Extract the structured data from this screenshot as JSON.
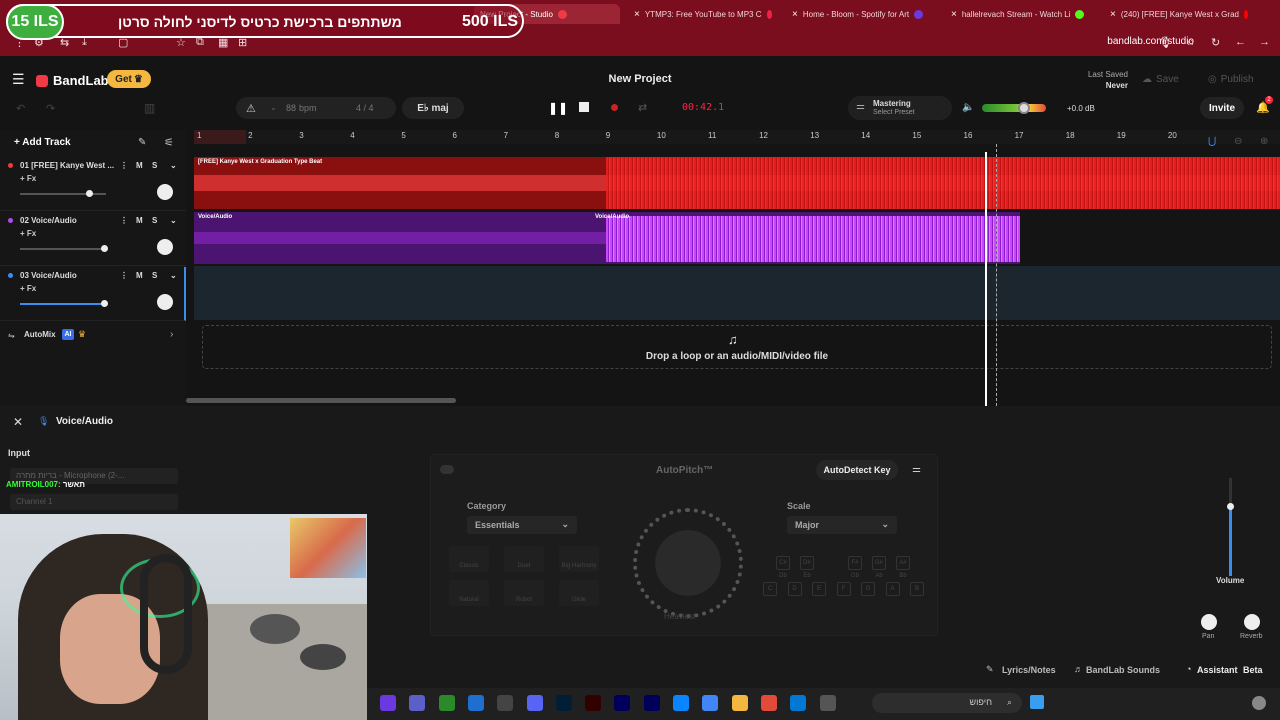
{
  "browser": {
    "tabs": [
      {
        "label": "New Project - Studio",
        "fav_color": "#f03a47"
      },
      {
        "label": "YTMP3: Free YouTube to MP3 C",
        "fav_color": "#e24"
      },
      {
        "label": "Home - Bloom - Spotify for Art",
        "fav_color": "#6a3ae0"
      },
      {
        "label": "hallelrevach Stream - Watch Li",
        "fav_color": "#53fc18"
      },
      {
        "label": "(240) [FREE] Kanye West x Grad",
        "fav_color": "#f00"
      }
    ],
    "url": "bandlab.com/studio"
  },
  "overlay": {
    "left_amount": "15 ILS",
    "message": "משתתפים ברכישת כרטיס לדיסני לחולה סרטן",
    "right_amount": "500 ILS"
  },
  "header": {
    "logo": "BandLab",
    "get_label": "Get",
    "project_title": "New Project",
    "last_saved_label": "Last Saved",
    "last_saved_value": "Never",
    "save_label": "Save",
    "publish_label": "Publish"
  },
  "transport": {
    "bpm_value": "88",
    "bpm_label": "bpm",
    "time_signature": "4 / 4",
    "key": "E♭ maj",
    "timecode": "00:42.1",
    "mastering_label": "Mastering",
    "mastering_preset": "Select Preset",
    "volume_db": "+0.0 dB",
    "invite_label": "Invite",
    "notif_count": "2"
  },
  "tracks_panel": {
    "add_track_label": "Add Track",
    "tracks": [
      {
        "name": "01  [FREE] Kanye West ...",
        "fx": "+ Fx",
        "m": "M",
        "s": "S",
        "color": "#f23a3a",
        "vol": 0.8
      },
      {
        "name": "02  Voice/Audio",
        "fx": "+ Fx",
        "m": "M",
        "s": "S",
        "color": "#b04af0",
        "vol": 0.98
      },
      {
        "name": "03  Voice/Audio",
        "fx": "+ Fx",
        "m": "M",
        "s": "S",
        "color": "#3a8ef0",
        "vol": 0.98
      }
    ],
    "automix_label": "AutoMix",
    "ai_badge": "AI"
  },
  "timeline": {
    "bars": [
      "1",
      "2",
      "3",
      "4",
      "5",
      "6",
      "7",
      "8",
      "9",
      "10",
      "11",
      "12",
      "13",
      "14",
      "15",
      "16",
      "17",
      "18",
      "19",
      "20"
    ],
    "clip1_label": "[FREE] Kanye West x Graduation Type Beat",
    "clip2a_label": "Voice/Audio",
    "clip2b_label": "Voice/Audio",
    "drop_text": "Drop a loop or an audio/MIDI/video file"
  },
  "editor": {
    "title": "Voice/Audio",
    "input_label": "Input",
    "mic_select": "בריות מחרה - Microphone (2-...",
    "channel_select": "Channel 1",
    "chat_user": "AMITROIL007:",
    "chat_msg": "תאשר",
    "autopitch_title": "AutoPitch™",
    "autodetect_label": "AutoDetect Key",
    "category_label": "Category",
    "category_value": "Essentials",
    "scale_label": "Scale",
    "scale_value": "Major",
    "dial_label": "Heaviest",
    "effects": [
      "Classic",
      "Duet",
      "Big Harmony",
      "Natural",
      "Robot",
      "Glide"
    ],
    "notes_top": [
      "C#\nDb",
      "D#\nEb",
      "F#\nGb",
      "G#\nAb",
      "A#\nBb"
    ],
    "notes_bottom": [
      "C",
      "D",
      "E",
      "F",
      "G",
      "A",
      "B"
    ],
    "volume_label": "Volume",
    "pan_label": "Pan",
    "reverb_label": "Reverb"
  },
  "bottom_bar": {
    "lyrics_label": "Lyrics/Notes",
    "sounds_label": "BandLab Sounds",
    "assistant_label": "Assistant",
    "beta_label": "Beta"
  },
  "taskbar": {
    "search_placeholder": "חיפוש"
  }
}
